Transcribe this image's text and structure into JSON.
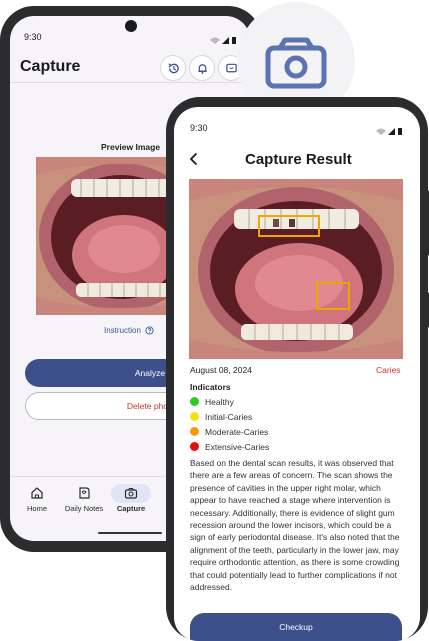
{
  "back_screen": {
    "status_time": "9:30",
    "title": "Capture",
    "preview_label": "Preview Image",
    "instruction_label": "Instruction",
    "analyze_label": "Analyze",
    "delete_label": "Delete photo",
    "nav": [
      {
        "label": "Home",
        "icon": "home-icon"
      },
      {
        "label": "Daily Notes",
        "icon": "notes-icon"
      },
      {
        "label": "Capture",
        "icon": "camera-icon",
        "active": true
      }
    ]
  },
  "front_screen": {
    "status_time": "9:30",
    "title": "Capture Result",
    "date": "August 08, 2024",
    "diagnosis": "Caries",
    "indicators_heading": "Indicators",
    "legend": [
      {
        "label": "Healthy",
        "color": "#2ecc1f"
      },
      {
        "label": "Initial-Caries",
        "color": "#f2e205"
      },
      {
        "label": "Moderate-Caries",
        "color": "#f39c12"
      },
      {
        "label": "Extensive-Caries",
        "color": "#e01010"
      }
    ],
    "summary": "Based on the dental scan results, it was observed that there are a few areas of concern. The scan shows the presence of cavities in the upper right molar, which appear to have reached a stage where intervention is necessary. Additionally, there is evidence of slight gum recession around the lower incisors, which could be a sign of early periodontal disease. It's also noted that the alignment of the teeth, particularly in the lower jaw, may require orthodontic attention, as there is some crowding that could potentially lead to further complications if not addressed.",
    "checkup_label": "Checkup"
  },
  "colors": {
    "accent": "#3c4f8a",
    "danger": "#d32f2f",
    "detection_box": "#f0a500"
  }
}
